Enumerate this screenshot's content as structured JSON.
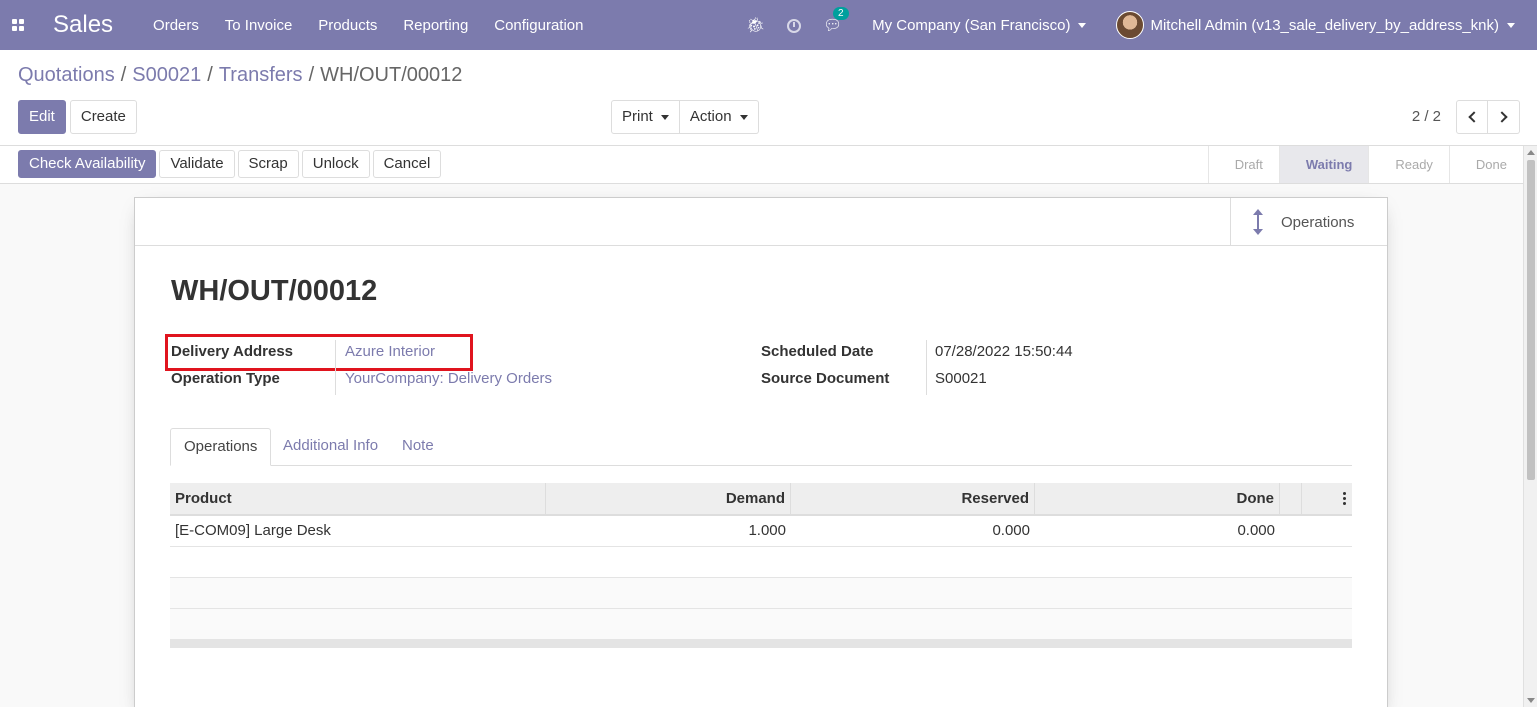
{
  "navbar": {
    "app_name": "Sales",
    "menu": [
      "Orders",
      "To Invoice",
      "Products",
      "Reporting",
      "Configuration"
    ],
    "chat_count": "2",
    "company": "My Company (San Francisco)",
    "user": "Mitchell Admin (v13_sale_delivery_by_address_knk)",
    "brand_color": "#7c7bad",
    "icons": [
      "apps-icon",
      "bug-icon",
      "clock-icon",
      "chat-icon"
    ]
  },
  "breadcrumb": {
    "items": [
      "Quotations",
      "S00021",
      "Transfers"
    ],
    "current": "WH/OUT/00012"
  },
  "control_panel": {
    "edit": "Edit",
    "create": "Create",
    "print": "Print",
    "action": "Action",
    "pager": "2 / 2"
  },
  "statusbar": {
    "buttons": [
      "Check Availability",
      "Validate",
      "Scrap",
      "Unlock",
      "Cancel"
    ],
    "stages": [
      "Draft",
      "Waiting",
      "Ready",
      "Done"
    ],
    "active_stage": "Waiting"
  },
  "sheet": {
    "smart_button": "Operations",
    "title": "WH/OUT/00012",
    "fields": {
      "delivery_address_label": "Delivery Address",
      "delivery_address_value": "Azure Interior",
      "operation_type_label": "Operation Type",
      "operation_type_value": "YourCompany: Delivery Orders",
      "scheduled_date_label": "Scheduled Date",
      "scheduled_date_value": "07/28/2022 15:50:44",
      "source_document_label": "Source Document",
      "source_document_value": "S00021"
    },
    "tabs": [
      "Operations",
      "Additional Info",
      "Note"
    ],
    "table": {
      "headers": [
        "Product",
        "Demand",
        "Reserved",
        "Done"
      ],
      "rows": [
        [
          "[E-COM09] Large Desk",
          "1.000",
          "0.000",
          "0.000"
        ]
      ]
    }
  }
}
